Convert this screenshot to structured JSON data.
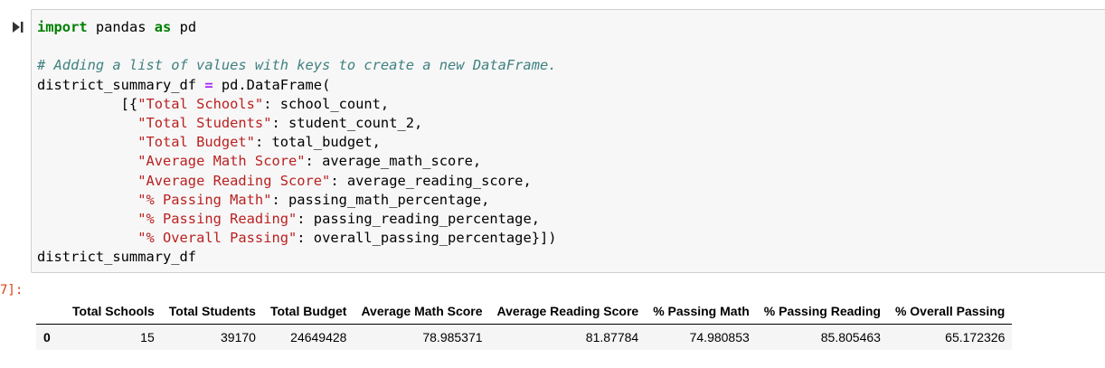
{
  "code_cell": {
    "run_icon": "run-cell-icon",
    "lines": [
      [
        {
          "t": "import",
          "c": "kw"
        },
        {
          "t": " pandas ",
          "c": ""
        },
        {
          "t": "as",
          "c": "kw"
        },
        {
          "t": " pd",
          "c": ""
        }
      ],
      [
        {
          "t": "",
          "c": ""
        }
      ],
      [
        {
          "t": "# Adding a list of values with keys to create a new DataFrame.",
          "c": "com"
        }
      ],
      [
        {
          "t": "district_summary_df ",
          "c": ""
        },
        {
          "t": "=",
          "c": "op"
        },
        {
          "t": " pd.DataFrame(",
          "c": ""
        }
      ],
      [
        {
          "t": "          [{",
          "c": ""
        },
        {
          "t": "\"Total Schools\"",
          "c": "str"
        },
        {
          "t": ": school_count,",
          "c": ""
        }
      ],
      [
        {
          "t": "            ",
          "c": ""
        },
        {
          "t": "\"Total Students\"",
          "c": "str"
        },
        {
          "t": ": student_count_2,",
          "c": ""
        }
      ],
      [
        {
          "t": "            ",
          "c": ""
        },
        {
          "t": "\"Total Budget\"",
          "c": "str"
        },
        {
          "t": ": total_budget,",
          "c": ""
        }
      ],
      [
        {
          "t": "            ",
          "c": ""
        },
        {
          "t": "\"Average Math Score\"",
          "c": "str"
        },
        {
          "t": ": average_math_score,",
          "c": ""
        }
      ],
      [
        {
          "t": "            ",
          "c": ""
        },
        {
          "t": "\"Average Reading Score\"",
          "c": "str"
        },
        {
          "t": ": average_reading_score,",
          "c": ""
        }
      ],
      [
        {
          "t": "            ",
          "c": ""
        },
        {
          "t": "\"% Passing Math\"",
          "c": "str"
        },
        {
          "t": ": passing_math_percentage,",
          "c": ""
        }
      ],
      [
        {
          "t": "            ",
          "c": ""
        },
        {
          "t": "\"% Passing Reading\"",
          "c": "str"
        },
        {
          "t": ": passing_reading_percentage,",
          "c": ""
        }
      ],
      [
        {
          "t": "            ",
          "c": ""
        },
        {
          "t": "\"% Overall Passing\"",
          "c": "str"
        },
        {
          "t": ": overall_passing_percentage}])",
          "c": ""
        }
      ],
      [
        {
          "t": "district_summary_df",
          "c": ""
        }
      ]
    ]
  },
  "output": {
    "prompt": "7]:",
    "table": {
      "columns": [
        "Total Schools",
        "Total Students",
        "Total Budget",
        "Average Math Score",
        "Average Reading Score",
        "% Passing Math",
        "% Passing Reading",
        "% Overall Passing"
      ],
      "rows": [
        {
          "index": "0",
          "values": [
            "15",
            "39170",
            "24649428",
            "78.985371",
            "81.87784",
            "74.980853",
            "85.805463",
            "65.172326"
          ]
        }
      ]
    }
  },
  "colors": {
    "keyword": "#008000",
    "comment": "#408080",
    "string": "#ba2121",
    "operator": "#aa22ff",
    "out_prompt": "#d84315",
    "cell_bg": "#f7f7f7"
  }
}
